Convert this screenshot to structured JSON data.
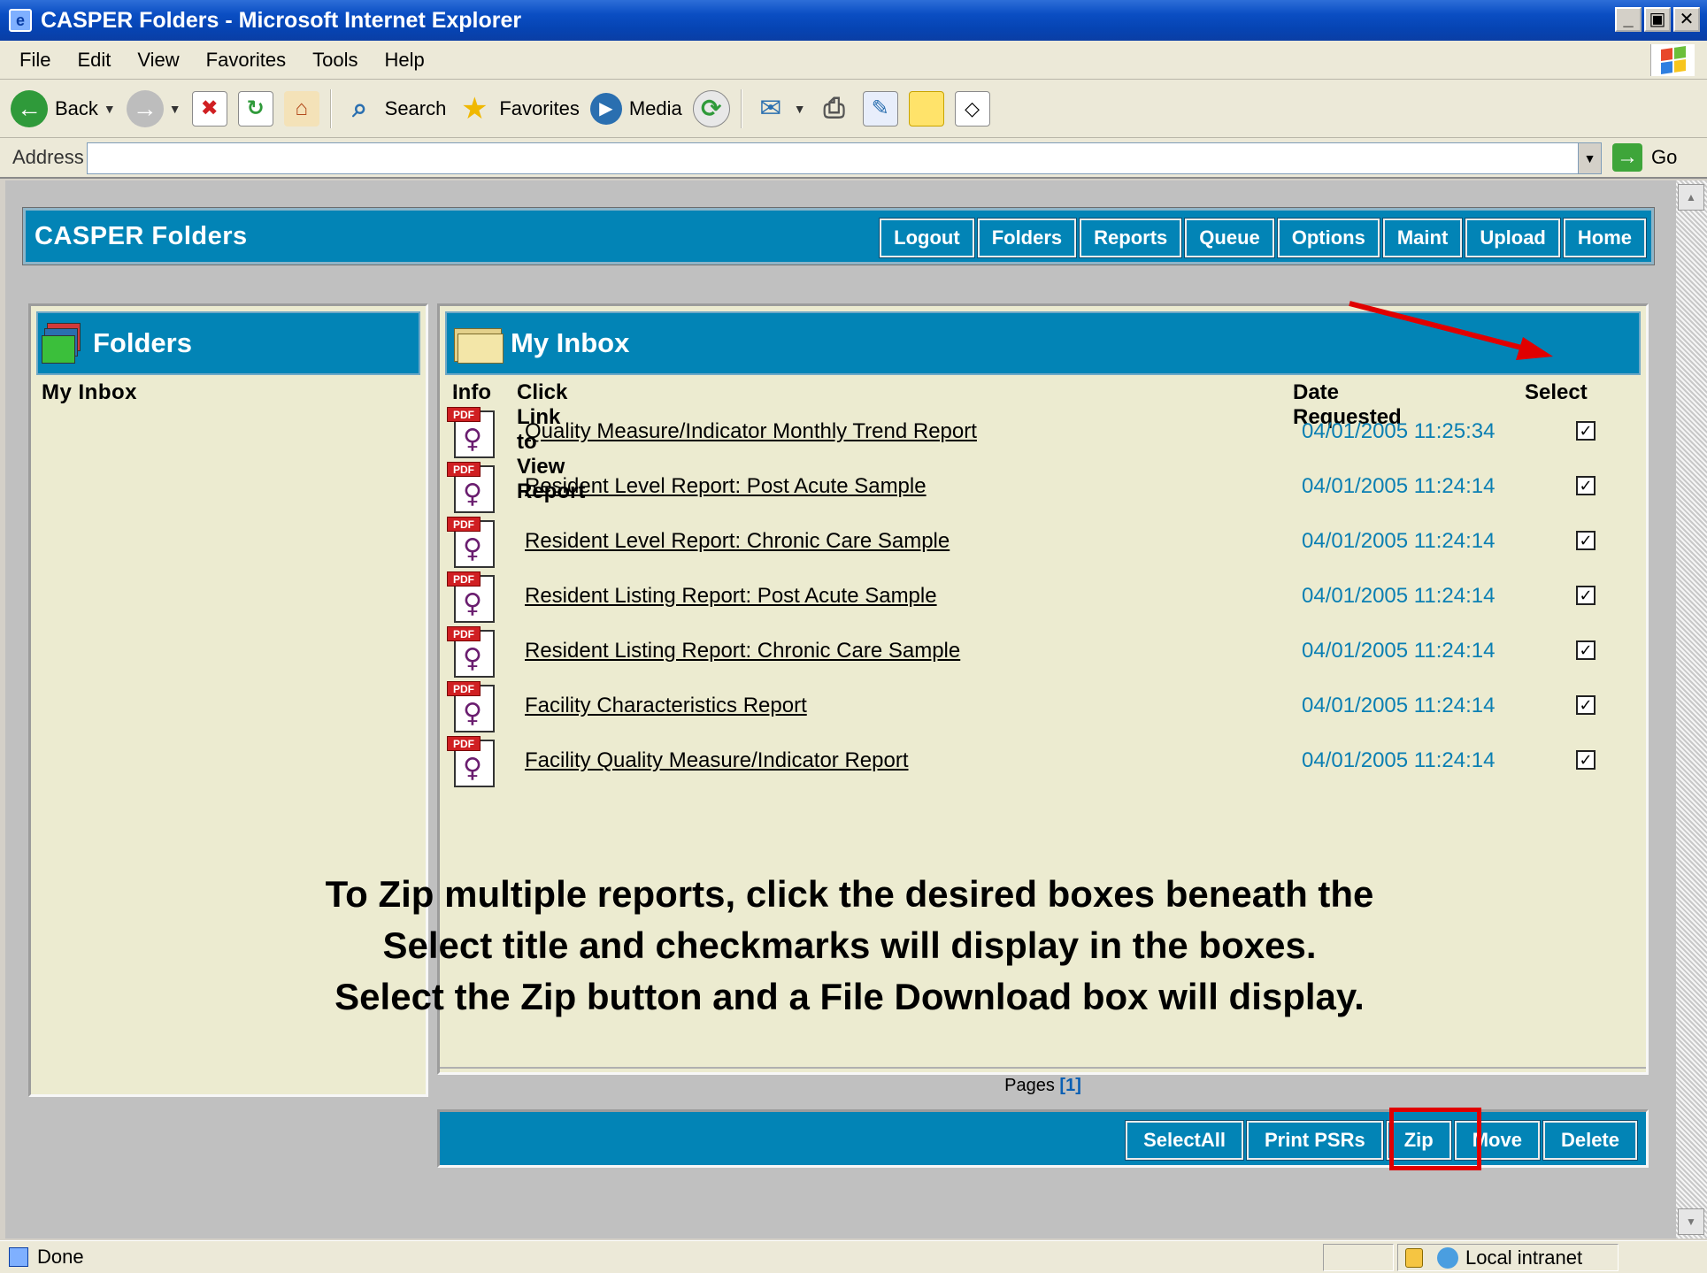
{
  "window": {
    "title": "CASPER Folders - Microsoft Internet Explorer"
  },
  "menu": [
    "File",
    "Edit",
    "View",
    "Favorites",
    "Tools",
    "Help"
  ],
  "toolbar": {
    "back": "Back",
    "search": "Search",
    "favorites": "Favorites",
    "media": "Media"
  },
  "address": {
    "label": "Address",
    "value": "",
    "go": "Go"
  },
  "app": {
    "title": "CASPER Folders",
    "nav": [
      "Logout",
      "Folders",
      "Reports",
      "Queue",
      "Options",
      "Maint",
      "Upload",
      "Home"
    ]
  },
  "sidebar": {
    "title": "Folders",
    "items": [
      "My Inbox"
    ]
  },
  "inbox": {
    "title": "My Inbox",
    "columns": {
      "info": "Info",
      "link": "Click Link to View Report",
      "date": "Date Requested",
      "select": "Select"
    },
    "rows": [
      {
        "icon": "pdf-icon",
        "title": "Quality Measure/Indicator Monthly Trend Report",
        "date": "04/01/2005 11:25:34",
        "checked": true
      },
      {
        "icon": "pdf-icon",
        "title": "Resident Level Report: Post Acute Sample",
        "date": "04/01/2005 11:24:14",
        "checked": true
      },
      {
        "icon": "pdf-icon",
        "title": "Resident Level Report: Chronic Care Sample",
        "date": "04/01/2005 11:24:14",
        "checked": true
      },
      {
        "icon": "pdf-icon",
        "title": "Resident Listing Report: Post Acute Sample",
        "date": "04/01/2005 11:24:14",
        "checked": true
      },
      {
        "icon": "pdf-icon",
        "title": "Resident Listing Report: Chronic Care Sample",
        "date": "04/01/2005 11:24:14",
        "checked": true
      },
      {
        "icon": "pdf-icon",
        "title": "Facility Characteristics Report",
        "date": "04/01/2005 11:24:14",
        "checked": true
      },
      {
        "icon": "pdf-icon",
        "title": "Facility Quality Measure/Indicator Report",
        "date": "04/01/2005 11:24:14",
        "checked": true
      }
    ],
    "pages_label": "Pages",
    "pages_value": "[1]"
  },
  "actions": [
    "SelectAll",
    "Print PSRs",
    "Zip",
    "Move",
    "Delete"
  ],
  "instruction": [
    "To Zip multiple reports, click the desired boxes beneath the",
    "Select title and checkmarks will display in the boxes.",
    "Select the Zip button and a File Download box will display."
  ],
  "status": {
    "text": "Done",
    "zone": "Local intranet"
  },
  "colors": {
    "teal": "#0284b6",
    "panel": "#ecebd0",
    "highlight": "#e00000",
    "date_text": "#0a7fb3"
  }
}
